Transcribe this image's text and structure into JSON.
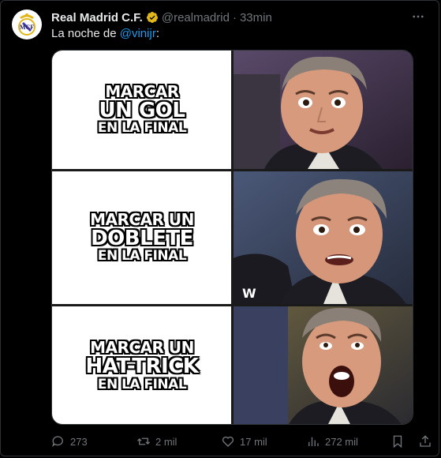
{
  "tweet": {
    "author_name": "Real Madrid C.F.",
    "handle": "@realmadrid",
    "separator": "·",
    "time": "33min",
    "more_label": "•••",
    "text_prefix": "La noche de ",
    "mention": "@vinijr",
    "text_suffix": ":"
  },
  "meme": {
    "panels": [
      {
        "lines": [
          "MARCAR",
          "UN GOL",
          "EN LA FINAL"
        ]
      },
      {
        "lines": [
          "MARCAR UN",
          "DOBLETE",
          "EN LA FINAL"
        ]
      },
      {
        "lines": [
          "MARCAR UN",
          "HAT-TRICK",
          "EN LA FINAL"
        ]
      }
    ]
  },
  "actions": {
    "replies": "273",
    "reposts": "2 mil",
    "likes": "17 mil",
    "views": "272 mil"
  },
  "colors": {
    "background": "#000000",
    "accent": "#1d9bf0",
    "verified_badge": "#e2b719",
    "muted": "#71767b",
    "text": "#e7e9ea"
  },
  "icons": {
    "reply": "reply-icon",
    "repost": "repost-icon",
    "like": "like-icon",
    "views": "views-icon",
    "bookmark": "bookmark-icon",
    "share": "share-icon",
    "verified": "verified-badge-icon",
    "more": "more-icon"
  }
}
